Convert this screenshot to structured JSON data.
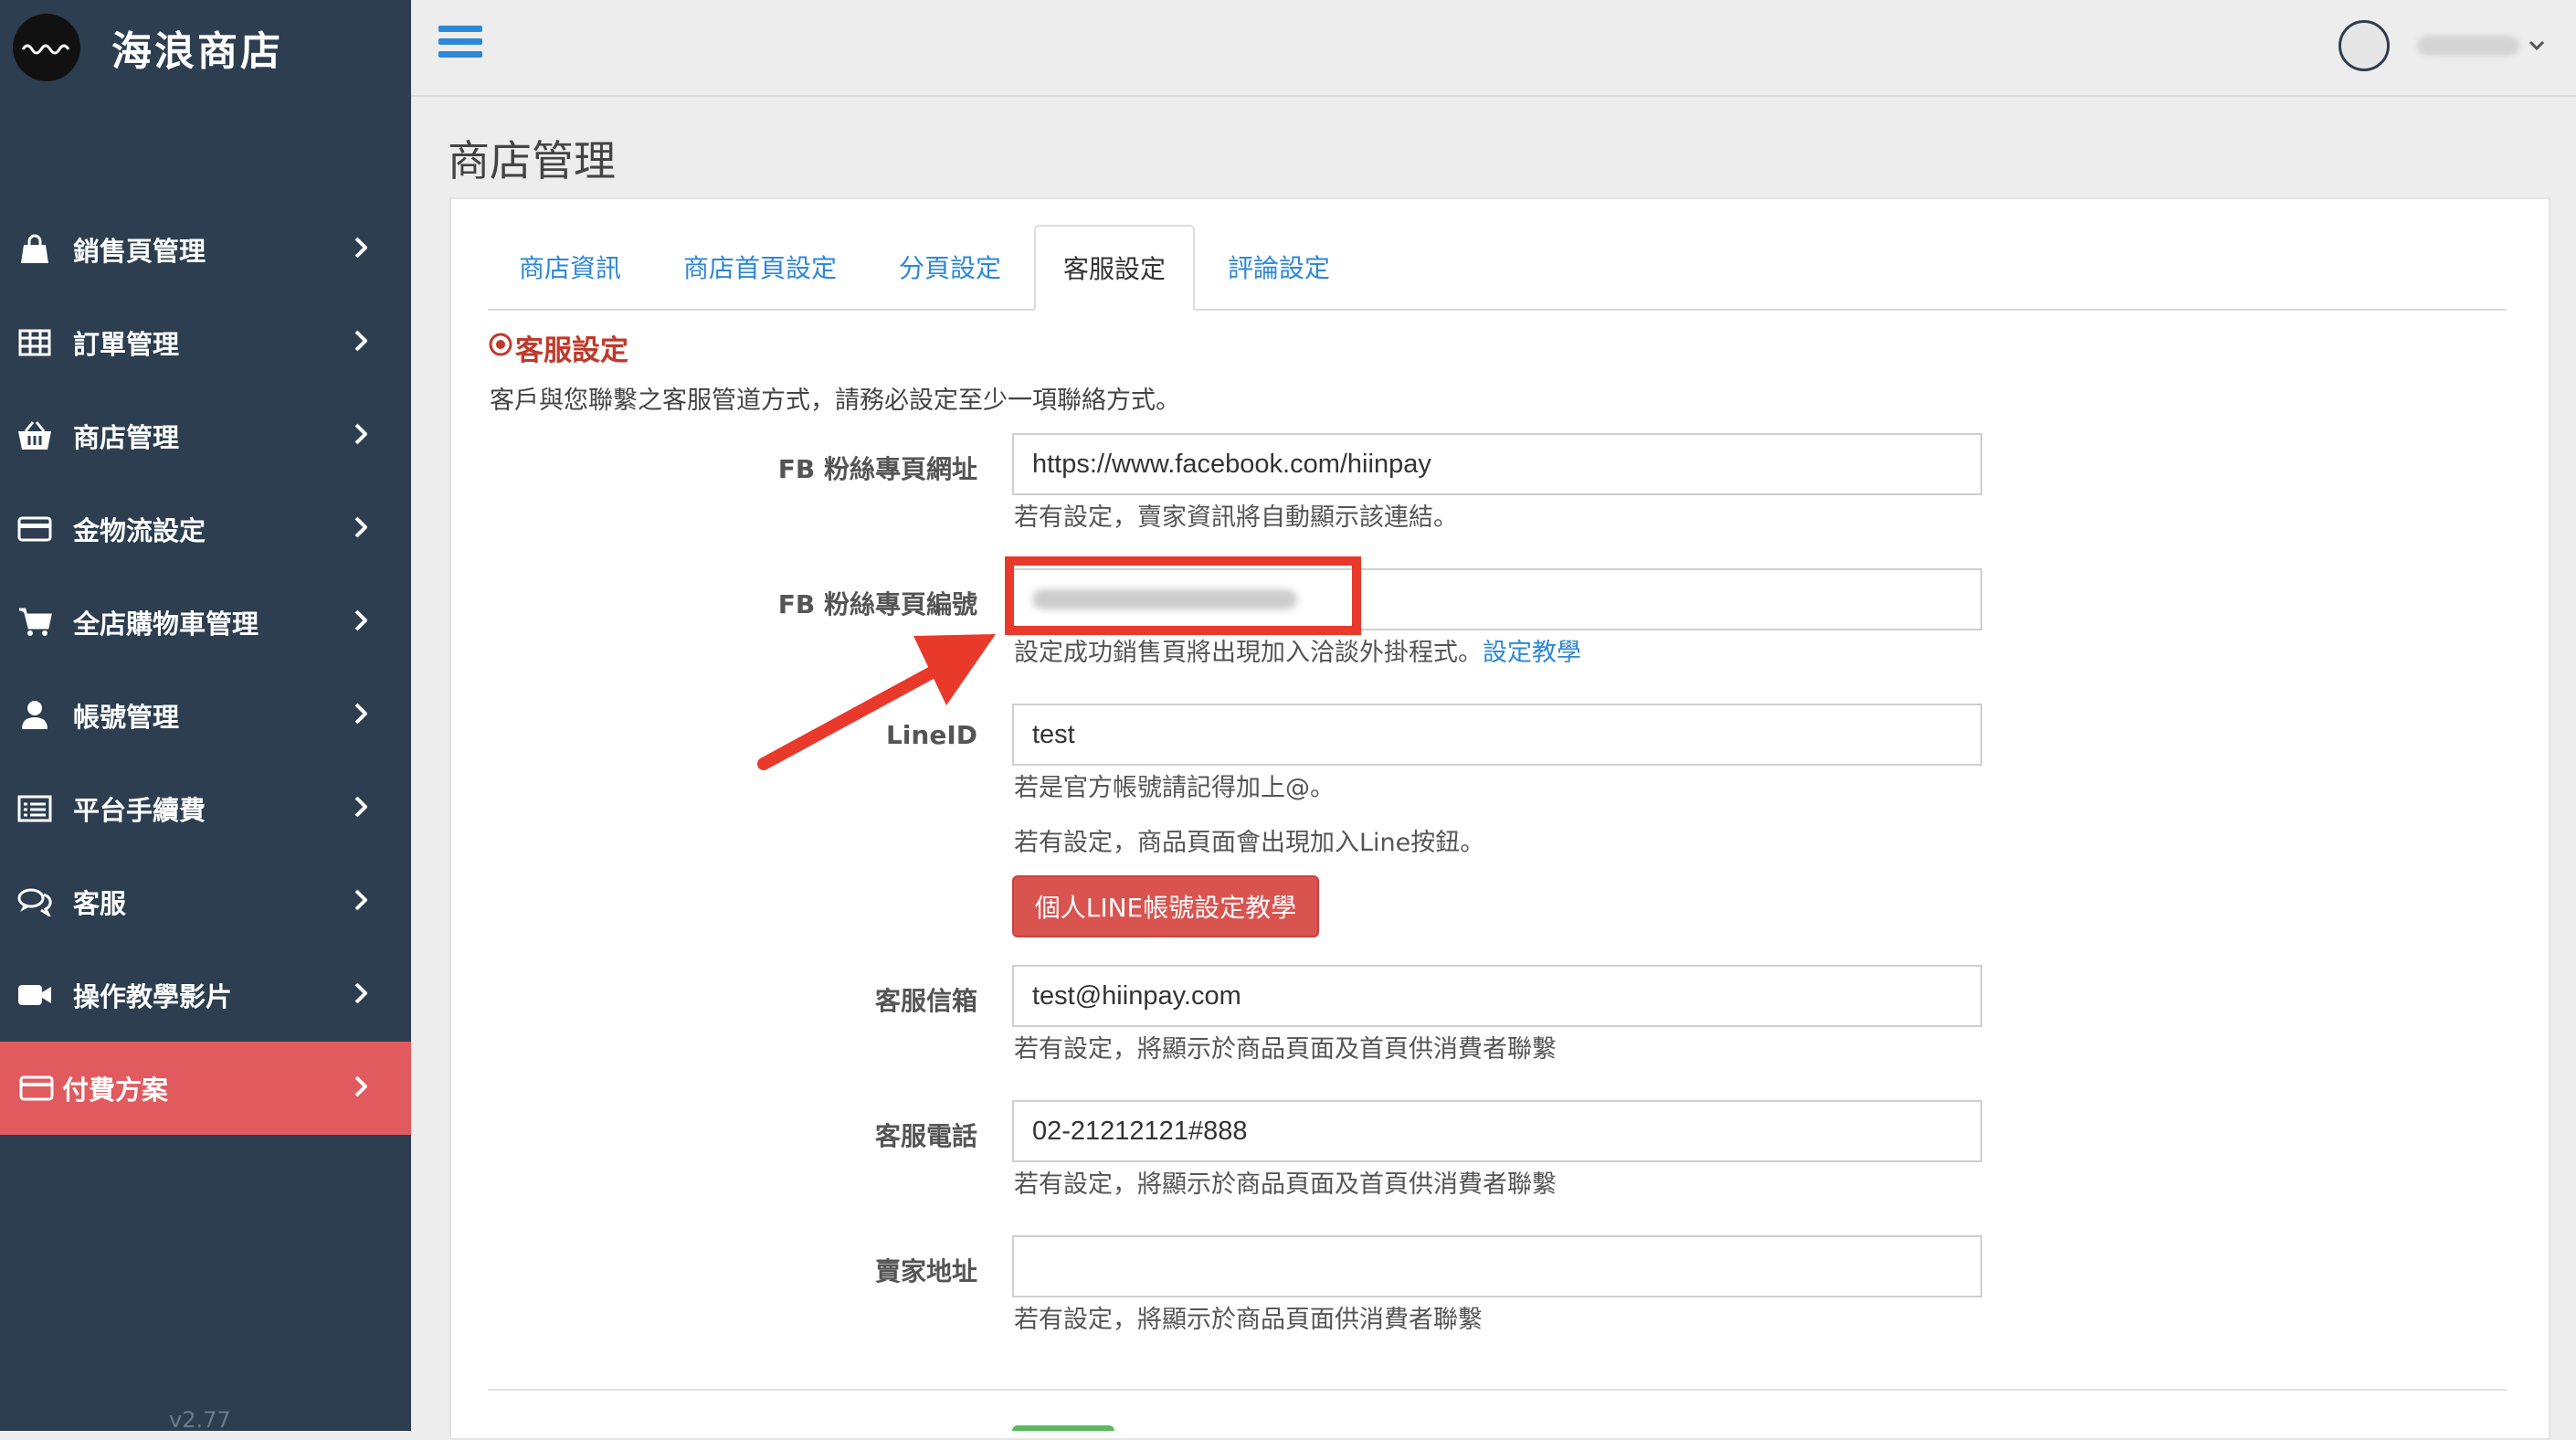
{
  "sidebar": {
    "brand": "海浪商店",
    "version": "v2.77",
    "items": [
      {
        "label": "銷售頁管理",
        "icon": "shopping-bag-icon"
      },
      {
        "label": "訂單管理",
        "icon": "table-icon"
      },
      {
        "label": "商店管理",
        "icon": "basket-icon"
      },
      {
        "label": "金物流設定",
        "icon": "credit-card-icon"
      },
      {
        "label": "全店購物車管理",
        "icon": "cart-icon"
      },
      {
        "label": "帳號管理",
        "icon": "user-icon"
      },
      {
        "label": "平台手續費",
        "icon": "list-icon"
      },
      {
        "label": "客服",
        "icon": "chat-icon"
      },
      {
        "label": "操作教學影片",
        "icon": "video-camera-icon"
      },
      {
        "label": "付費方案",
        "icon": "credit-card-icon",
        "active": true
      }
    ]
  },
  "header": {
    "page_title": "商店管理"
  },
  "tabs": [
    {
      "label": "商店資訊"
    },
    {
      "label": "商店首頁設定"
    },
    {
      "label": "分頁設定"
    },
    {
      "label": "客服設定",
      "active": true
    },
    {
      "label": "評論設定"
    }
  ],
  "section": {
    "title": "客服設定",
    "description": "客戶與您聯繫之客服管道方式，請務必設定至少一項聯絡方式。"
  },
  "form": {
    "fb_url": {
      "label": "FB 粉絲專頁網址",
      "value": "https://www.facebook.com/hiinpay",
      "help": "若有設定，賣家資訊將自動顯示該連結。"
    },
    "fb_id": {
      "label": "FB 粉絲專頁編號",
      "help": "設定成功銷售頁將出現加入洽談外掛程式。",
      "help_link": "設定教學"
    },
    "line_id": {
      "label": "LineID",
      "value": "test",
      "help1": "若是官方帳號請記得加上@。",
      "help2": "若有設定，商品頁面會出現加入Line按鈕。",
      "button": "個人LINE帳號設定教學"
    },
    "email": {
      "label": "客服信箱",
      "value": "test@hiinpay.com",
      "help": "若有設定，將顯示於商品頁面及首頁供消費者聯繫"
    },
    "phone": {
      "label": "客服電話",
      "value": "02-21212121#888",
      "help": "若有設定，將顯示於商品頁面及首頁供消費者聯繫"
    },
    "address": {
      "label": "賣家地址",
      "value": "",
      "help": "若有設定，將顯示於商品頁面供消費者聯繫"
    }
  },
  "colors": {
    "sidebar_bg": "#2c3e50",
    "active_item": "#e05a5e",
    "link": "#2e88d8",
    "danger_button": "#d9534f",
    "annotation": "#e8392b"
  }
}
